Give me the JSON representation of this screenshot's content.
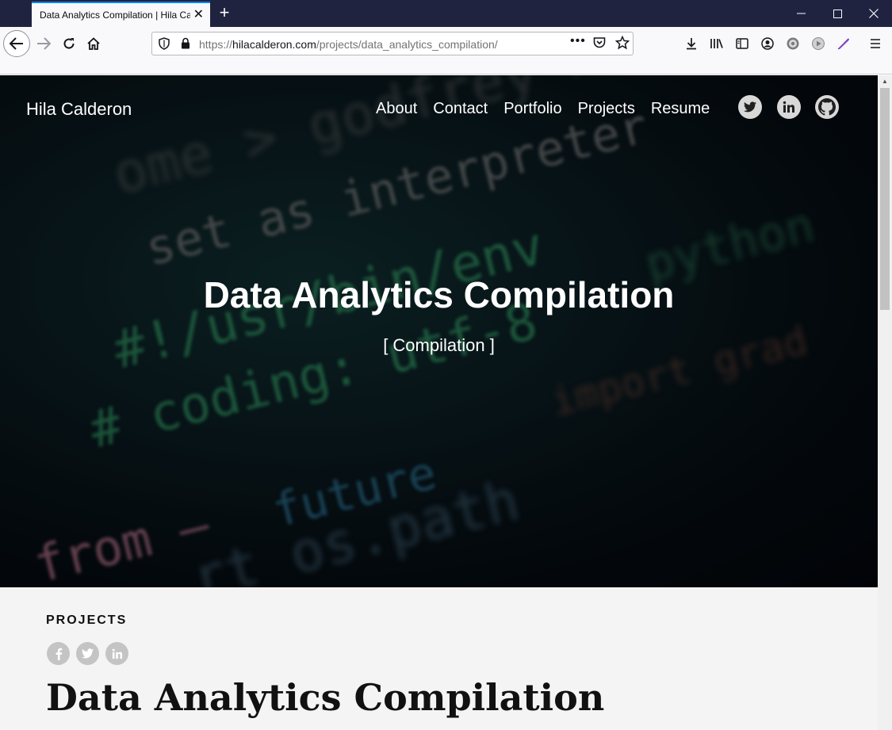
{
  "browser": {
    "tab_title": "Data Analytics Compilation | Hila Calderon",
    "url_prefix": "https://",
    "url_domain": "hilacalderon.com",
    "url_path": "/projects/data_analytics_compilation/",
    "colors": {
      "titlebar": "#202340",
      "accent": "#0a84ff"
    }
  },
  "site": {
    "name": "Hila Calderon",
    "nav": [
      "About",
      "Contact",
      "Portfolio",
      "Projects",
      "Resume"
    ],
    "header_social": [
      "twitter-icon",
      "linkedin-icon",
      "github-icon"
    ]
  },
  "hero": {
    "title": "Data Analytics Compilation",
    "subtitle": "[ Compilation ]"
  },
  "content": {
    "section_label": "PROJECTS",
    "share_icons": [
      "facebook-icon",
      "twitter-icon",
      "linkedin-icon"
    ],
    "article_title": "Data Analytics Compilation"
  }
}
